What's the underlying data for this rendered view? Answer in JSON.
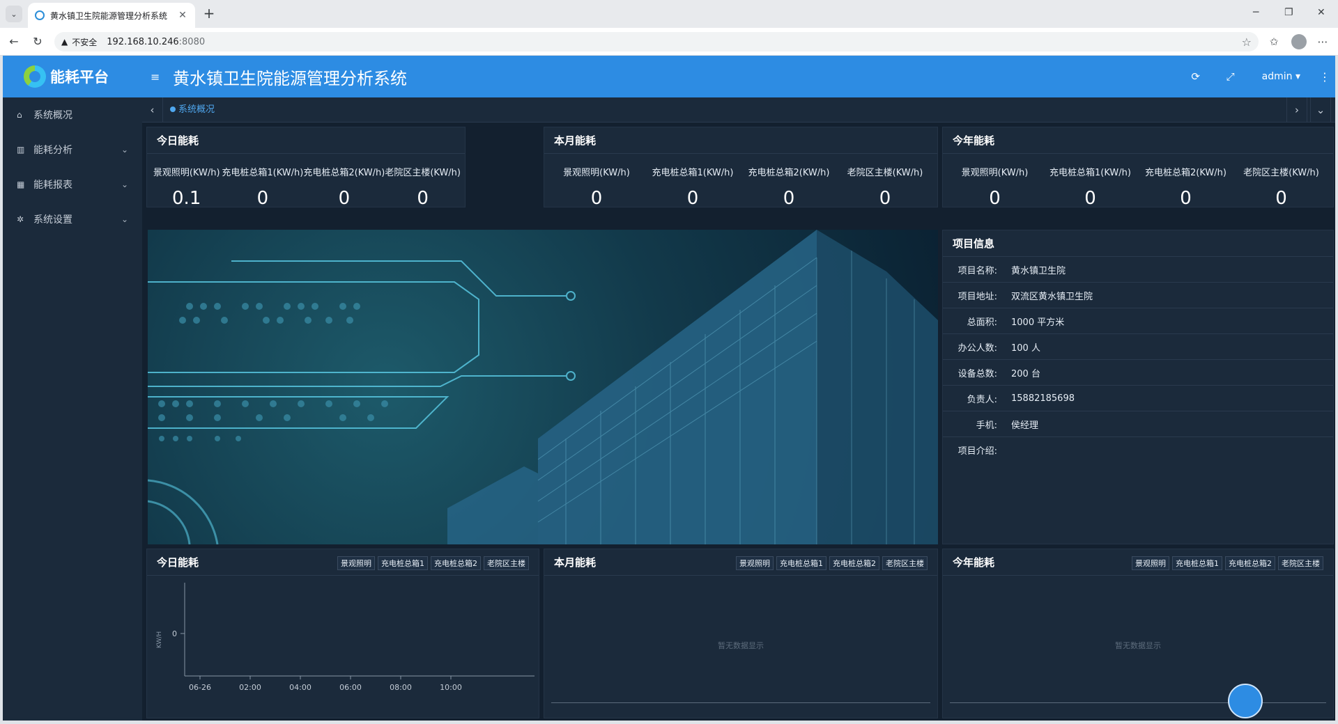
{
  "browser": {
    "tab_title": "黄水镇卫生院能源管理分析系统",
    "address_warning": "不安全",
    "url_host": "192.168.10.246",
    "url_port": ":8080"
  },
  "sidebar": {
    "brand": "能耗平台",
    "items": [
      {
        "label": "系统概况",
        "icon": "home-icon"
      },
      {
        "label": "能耗分析",
        "icon": "bar-chart-icon"
      },
      {
        "label": "能耗报表",
        "icon": "table-icon"
      },
      {
        "label": "系统设置",
        "icon": "gear-icon"
      }
    ]
  },
  "header": {
    "title": "黄水镇卫生院能源管理分析系统",
    "user": "admin"
  },
  "tags": {
    "active": "系统概况"
  },
  "today": {
    "title": "今日能耗",
    "metrics": [
      {
        "label": "景观照明(KW/h)",
        "value": "0.1"
      },
      {
        "label": "充电桩总箱1(KW/h)",
        "value": "0"
      },
      {
        "label": "充电桩总箱2(KW/h)",
        "value": "0"
      },
      {
        "label": "老院区主楼(KW/h)",
        "value": "0"
      }
    ]
  },
  "month": {
    "title": "本月能耗",
    "metrics": [
      {
        "label": "景观照明(KW/h)",
        "value": "0"
      },
      {
        "label": "充电桩总箱1(KW/h)",
        "value": "0"
      },
      {
        "label": "充电桩总箱2(KW/h)",
        "value": "0"
      },
      {
        "label": "老院区主楼(KW/h)",
        "value": "0"
      }
    ]
  },
  "year": {
    "title": "今年能耗",
    "metrics": [
      {
        "label": "景观照明(KW/h)",
        "value": "0"
      },
      {
        "label": "充电桩总箱1(KW/h)",
        "value": "0"
      },
      {
        "label": "充电桩总箱2(KW/h)",
        "value": "0"
      },
      {
        "label": "老院区主楼(KW/h)",
        "value": "0"
      }
    ]
  },
  "project": {
    "title": "项目信息",
    "rows": [
      {
        "k": "项目名称:",
        "v": "黄水镇卫生院"
      },
      {
        "k": "项目地址:",
        "v": "双流区黄水镇卫生院"
      },
      {
        "k": "总面积:",
        "v": "1000 平方米"
      },
      {
        "k": "办公人数:",
        "v": "100 人"
      },
      {
        "k": "设备总数:",
        "v": "200 台"
      },
      {
        "k": "负责人:",
        "v": "15882185698"
      },
      {
        "k": "手机:",
        "v": "侯经理"
      },
      {
        "k": "项目介绍:",
        "v": ""
      }
    ]
  },
  "charts": {
    "legend": [
      "景观照明",
      "充电桩总箱1",
      "充电桩总箱2",
      "老院区主楼"
    ],
    "today_title": "今日能耗",
    "month_title": "本月能耗",
    "year_title": "今年能耗",
    "no_data": "暂无数据显示",
    "y_unit": "KW/H",
    "y_tick": "0",
    "x_ticks": [
      "06-26",
      "02:00",
      "04:00",
      "06:00",
      "08:00",
      "10:00"
    ]
  },
  "colors": {
    "accent": "#2d8ce3",
    "panel": "#1b2a3b",
    "bg": "#13202f"
  }
}
